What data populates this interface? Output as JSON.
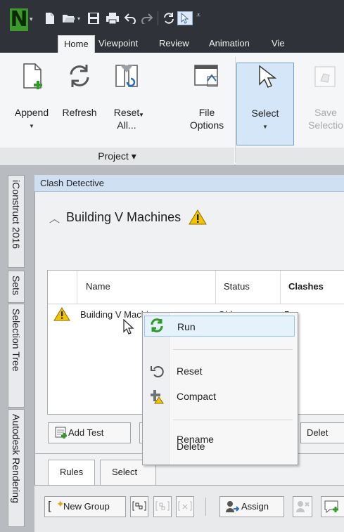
{
  "app": {
    "logo_letter": "N",
    "colors": {
      "accent": "#3b9a2b",
      "titlebar": "#2f3238",
      "selection": "#d4e6f8",
      "warning": "#f5c400"
    }
  },
  "quick_access": {
    "icons": [
      "new-file-icon",
      "open-folder-icon",
      "save-icon",
      "print-icon",
      "undo-icon",
      "redo-icon",
      "refresh-icon",
      "select-cursor-icon",
      "customize-dropdown-icon"
    ]
  },
  "tabs": [
    {
      "label": "Home",
      "active": true
    },
    {
      "label": "Viewpoint"
    },
    {
      "label": "Review"
    },
    {
      "label": "Animation"
    },
    {
      "label": "Vie"
    }
  ],
  "ribbon": {
    "append": "Append",
    "refresh": "Refresh",
    "reset_all": "Reset\nAll...",
    "file_options": "File\nOptions",
    "select": "Select",
    "save_selection": "Save\nSelectio",
    "project_panel": "Project ▾"
  },
  "side_tabs": [
    "iConstruct 2016",
    "Sets",
    "Selection Tree",
    "Autodesk Rendering"
  ],
  "clash_detective": {
    "panel_title": "Clash Detective",
    "test_title": "Building V Machines",
    "grid": {
      "columns": [
        "Name",
        "Status",
        "Clashes"
      ],
      "row": {
        "name": "Building V Machines",
        "status": "Old",
        "clashes": "5"
      }
    },
    "buttons": {
      "add_test": "Add Test",
      "delete": "Delet"
    },
    "subtabs": [
      "Rules",
      "Select"
    ],
    "toolbar": {
      "new_group": "New Group",
      "assign": "Assign"
    }
  },
  "context_menu": {
    "items": [
      {
        "label": "Run",
        "icon": "run-refresh-icon",
        "highlighted": true
      },
      {
        "label": "Reset",
        "icon": "reset-icon"
      },
      {
        "label": "Compact",
        "icon": "compact-icon"
      },
      {
        "label": "Rename"
      },
      {
        "label": "Delete"
      }
    ]
  }
}
